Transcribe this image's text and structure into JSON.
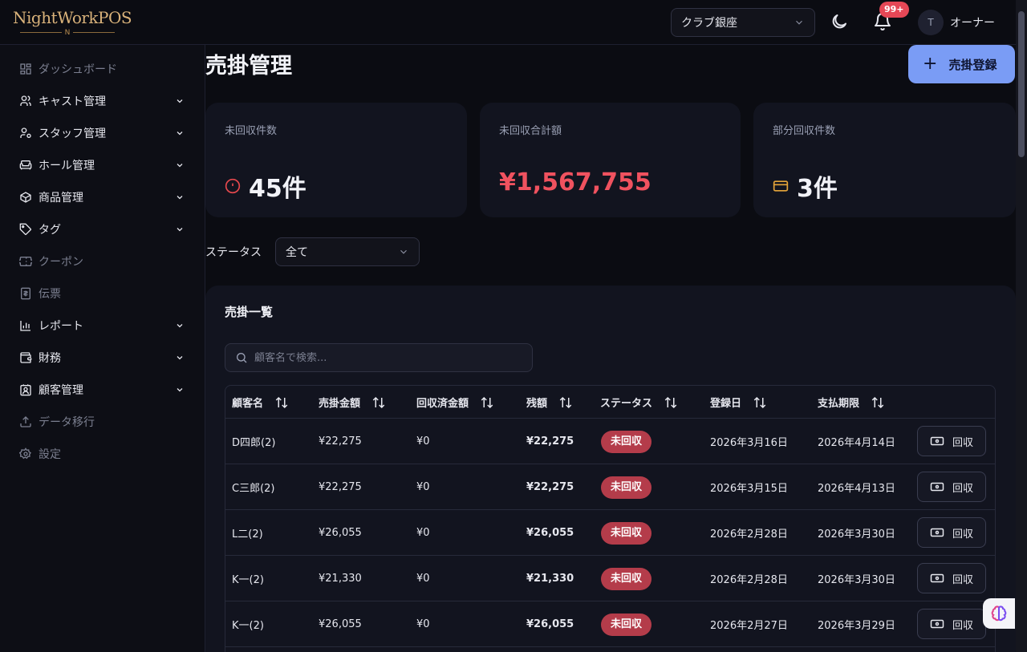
{
  "header": {
    "logo_text": "NightWorkPOS",
    "logo_mark": "N",
    "store_selected": "クラブ銀座",
    "notification_badge": "99+",
    "user_initial": "T",
    "user_name": "オーナー"
  },
  "sidebar": {
    "items": [
      {
        "label": "ダッシュボード",
        "icon": "dashboard-icon",
        "expandable": false,
        "dim": true
      },
      {
        "label": "キャスト管理",
        "icon": "users-icon",
        "expandable": true,
        "dim": false
      },
      {
        "label": "スタッフ管理",
        "icon": "user-cog-icon",
        "expandable": true,
        "dim": false
      },
      {
        "label": "ホール管理",
        "icon": "sofa-icon",
        "expandable": true,
        "dim": false
      },
      {
        "label": "商品管理",
        "icon": "package-icon",
        "expandable": true,
        "dim": false
      },
      {
        "label": "タグ",
        "icon": "tag-icon",
        "expandable": true,
        "dim": false
      },
      {
        "label": "クーポン",
        "icon": "ticket-icon",
        "expandable": false,
        "dim": true
      },
      {
        "label": "伝票",
        "icon": "receipt-icon",
        "expandable": false,
        "dim": true
      },
      {
        "label": "レポート",
        "icon": "bar-chart-icon",
        "expandable": true,
        "dim": false
      },
      {
        "label": "財務",
        "icon": "wallet-icon",
        "expandable": true,
        "dim": false
      },
      {
        "label": "顧客管理",
        "icon": "contact-icon",
        "expandable": true,
        "dim": false
      },
      {
        "label": "データ移行",
        "icon": "upload-icon",
        "expandable": false,
        "dim": true
      },
      {
        "label": "設定",
        "icon": "settings-icon",
        "expandable": false,
        "dim": true
      }
    ]
  },
  "main": {
    "title": "売掛管理",
    "add_button": "売掛登録",
    "cards": [
      {
        "label": "未回収件数",
        "value": "45件",
        "color": "#f2f3f8",
        "icon_color": "#e5484d"
      },
      {
        "label": "未回収合計額",
        "value": "¥1,567,755",
        "color": "#f0525f",
        "icon_color": ""
      },
      {
        "label": "部分回収件数",
        "value": "3件",
        "color": "#f2f3f8",
        "icon_color": "#e5a53a"
      }
    ],
    "status_filter_label": "ステータス",
    "status_filter_value": "全て",
    "list_title": "売掛一覧",
    "search_placeholder": "顧客名で検索..."
  },
  "table": {
    "headers": [
      "顧客名",
      "売掛金額",
      "回収済金額",
      "残額",
      "ステータス",
      "登録日",
      "支払期限"
    ],
    "rows": [
      {
        "customer": "D四郎(2)",
        "amount": "¥22,275",
        "collected": "¥0",
        "remaining": "¥22,275",
        "status": "未回収",
        "registered": "2026年3月16日",
        "due": "2026年4月14日",
        "action": "回収"
      },
      {
        "customer": "C三郎(2)",
        "amount": "¥22,275",
        "collected": "¥0",
        "remaining": "¥22,275",
        "status": "未回収",
        "registered": "2026年3月15日",
        "due": "2026年4月13日",
        "action": "回収"
      },
      {
        "customer": "L二(2)",
        "amount": "¥26,055",
        "collected": "¥0",
        "remaining": "¥26,055",
        "status": "未回収",
        "registered": "2026年2月28日",
        "due": "2026年3月30日",
        "action": "回収"
      },
      {
        "customer": "K一(2)",
        "amount": "¥21,330",
        "collected": "¥0",
        "remaining": "¥21,330",
        "status": "未回収",
        "registered": "2026年2月28日",
        "due": "2026年3月30日",
        "action": "回収"
      },
      {
        "customer": "K一(2)",
        "amount": "¥26,055",
        "collected": "¥0",
        "remaining": "¥26,055",
        "status": "未回収",
        "registered": "2026年2月27日",
        "due": "2026年3月29日",
        "action": "回収"
      }
    ]
  },
  "colors": {
    "accent": "#7a9cf5",
    "danger": "#f0525f",
    "badge": "#b43c4a"
  }
}
